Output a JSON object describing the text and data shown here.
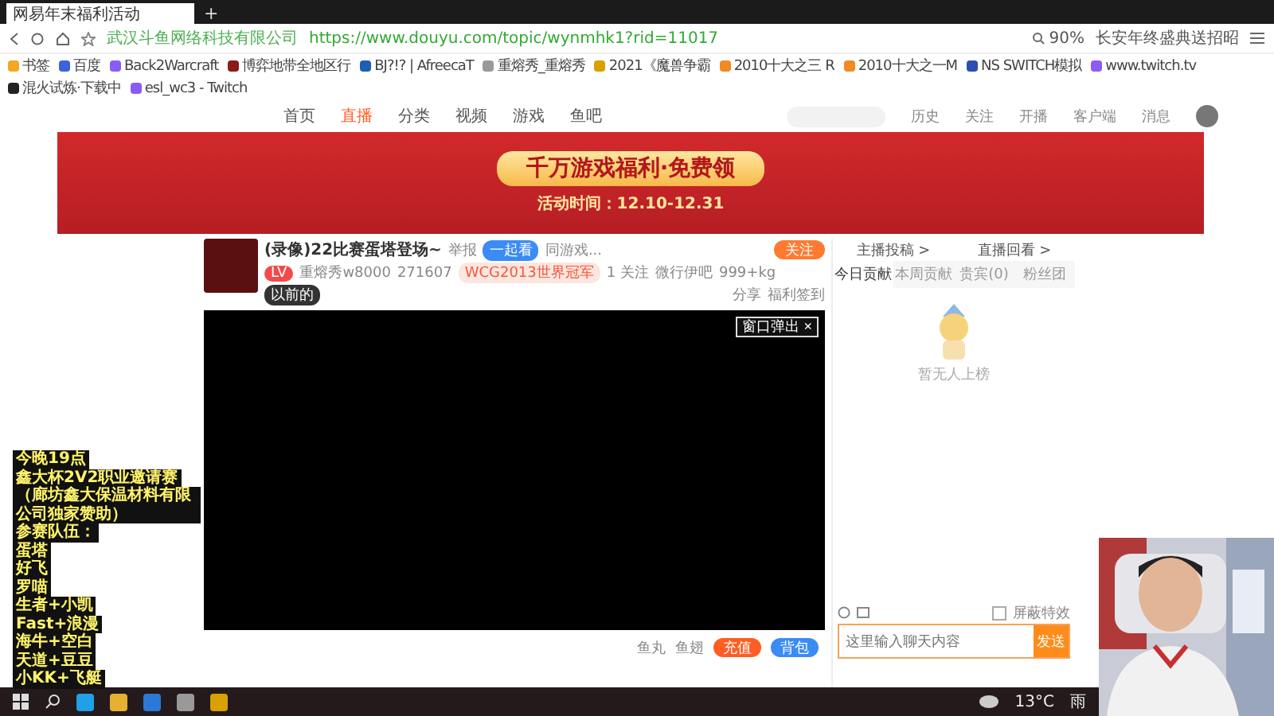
{
  "browser": {
    "tab_title": "网易年末福利活动",
    "new_tab": "+",
    "site_owner": "武汉斗鱼网络科技有限公司",
    "url": "https://www.douyu.com/topic/wynmhk1?rid=11017",
    "zoom": "90%",
    "search": "长安年终盛典送招昭"
  },
  "bookmarks": [
    "书签",
    "百度",
    "Back2Warcraft",
    "博弈地带全地区行",
    "BJ?!? | AfreecaT",
    "重熔秀_重熔秀",
    "2021《魔兽争霸",
    "2010十大之三 R",
    "2010十大之一M",
    "NS SWITCH模拟",
    "www.twitch.tv",
    "混火试炼·下载中",
    "esl_wc3 - Twitch"
  ],
  "site_nav": {
    "items": [
      {
        "label": "首页",
        "selected": false
      },
      {
        "label": "直播",
        "selected": true
      },
      {
        "label": "分类",
        "selected": false
      },
      {
        "label": "视频",
        "selected": false
      },
      {
        "label": "游戏",
        "selected": false
      },
      {
        "label": "鱼吧",
        "selected": false
      }
    ],
    "user_links": [
      "历史",
      "关注",
      "开播",
      "客户端",
      "消息"
    ]
  },
  "banner": {
    "headline": "千万游戏福利·免费领",
    "period": "活动时间：12.10-12.31"
  },
  "room": {
    "title": "(录像)22比赛蛋塔登场~",
    "report": "举报",
    "watch_badge": "一起看",
    "category": "同游戏...",
    "level": "LV",
    "owner": "重熔秀w8000",
    "heat": "271607",
    "honor": "WCG2013世界冠军",
    "followers": "1 关注",
    "fan_group": "微行伊吧",
    "weight": "999+kg",
    "tag": "以前的",
    "share": "分享",
    "signin": "福利签到",
    "follow": "关注"
  },
  "video": {
    "popout": "窗口弹出",
    "close": "×"
  },
  "gifts": [
    "鱼丸",
    "鱼翅"
  ],
  "recharge": "充值",
  "backpack": "背包",
  "side": {
    "links": [
      "主播投稿 >",
      "直播回看 >"
    ],
    "tabs": [
      {
        "label": "今日贡献",
        "selected": true
      },
      {
        "label": "本周贡献",
        "selected": false
      },
      {
        "label": "贵宾(0)",
        "selected": false
      },
      {
        "label": "粉丝团",
        "selected": false
      }
    ],
    "empty": "暂无人上榜",
    "block_effects": {
      "label": "屏蔽特效",
      "checked": false
    },
    "chat_placeholder": "这里输入聊天内容",
    "send": "发送"
  },
  "overlay_lines": [
    "今晚19点",
    "鑫大杯2V2职业邀请赛",
    "（廊坊鑫大保温材料有限公司独家赞助）",
    "参赛队伍：",
    "蛋塔",
    "好飞",
    "罗喵",
    "生者+小凯",
    "Fast+浪漫",
    "海牛+空白",
    "天道+豆豆",
    "小KK+飞艇"
  ],
  "taskbar": {
    "temperature": "13°C",
    "weather": "雨"
  }
}
